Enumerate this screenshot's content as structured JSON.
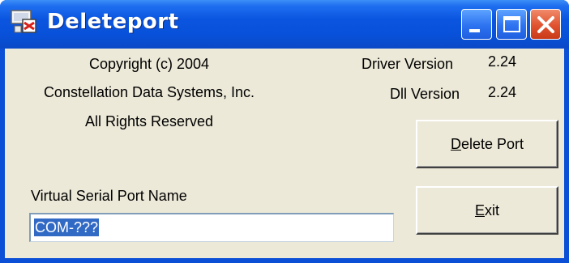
{
  "window": {
    "title": "Deleteport"
  },
  "about": {
    "copyright": "Copyright (c) 2004",
    "company": "Constellation Data Systems, Inc.",
    "rights": "All Rights Reserved"
  },
  "versions": {
    "driver_label": "Driver Version",
    "driver_value": "2.24",
    "dll_label": "Dll Version",
    "dll_value": "2.24"
  },
  "buttons": {
    "delete_port_accel": "D",
    "delete_port_rest": "elete Port",
    "exit_accel": "E",
    "exit_rest": "xit"
  },
  "port": {
    "label": "Virtual Serial Port Name",
    "value": "COM-???"
  },
  "icons": {
    "app": "app-icon",
    "minimize": "minimize-icon",
    "maximize": "maximize-icon",
    "close": "close-icon"
  },
  "colors": {
    "titlebar": "#0a55e0",
    "client_bg": "#ece9d8",
    "close_button": "#e0522f",
    "selection": "#316ac5"
  }
}
